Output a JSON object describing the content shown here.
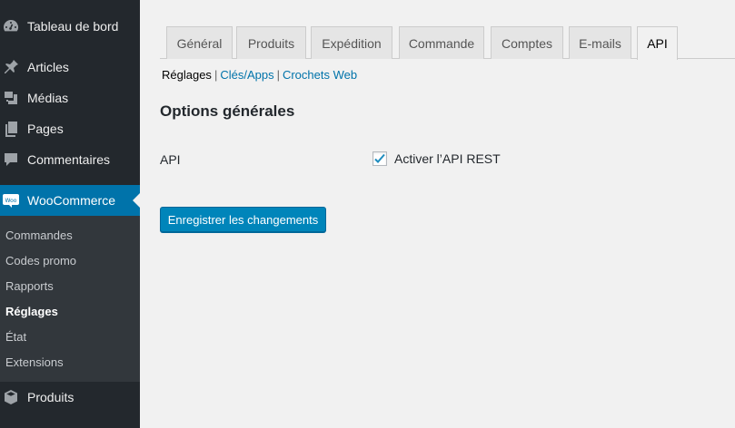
{
  "sidebar": {
    "items": [
      {
        "label": "Tableau de bord",
        "icon": "dashboard-icon"
      },
      {
        "label": "Articles",
        "icon": "pin-icon"
      },
      {
        "label": "Médias",
        "icon": "media-icon"
      },
      {
        "label": "Pages",
        "icon": "pages-icon"
      },
      {
        "label": "Commentaires",
        "icon": "comment-icon"
      },
      {
        "label": "WooCommerce",
        "icon": "woocommerce-icon"
      },
      {
        "label": "Produits",
        "icon": "box-icon"
      }
    ],
    "submenu": [
      {
        "label": "Commandes"
      },
      {
        "label": "Codes promo"
      },
      {
        "label": "Rapports"
      },
      {
        "label": "Réglages"
      },
      {
        "label": "État"
      },
      {
        "label": "Extensions"
      }
    ],
    "woo_logo_text": "Woo"
  },
  "tabs": [
    {
      "label": "Général"
    },
    {
      "label": "Produits"
    },
    {
      "label": "Expédition"
    },
    {
      "label": "Commande"
    },
    {
      "label": "Comptes"
    },
    {
      "label": "E-mails"
    },
    {
      "label": "API"
    }
  ],
  "subnav": {
    "current": "Réglages",
    "links": [
      "Clés/Apps",
      "Crochets Web"
    ],
    "separator": "|"
  },
  "section": {
    "title": "Options générales"
  },
  "field": {
    "label": "API",
    "checkbox_label": "Activer l’API REST",
    "checked": true
  },
  "save_button": "Enregistrer les changements",
  "colors": {
    "sidebar_bg": "#23282d",
    "submenu_bg": "#32373c",
    "accent": "#0073aa",
    "button_bg": "#0085ba"
  }
}
